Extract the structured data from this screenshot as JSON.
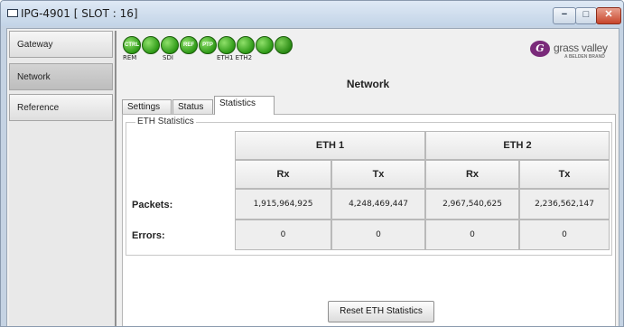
{
  "window": {
    "title": "IPG-4901 [ SLOT : 16]",
    "controls": {
      "minimize": "−",
      "maximize": "□",
      "close": "✕"
    }
  },
  "sidebar": {
    "items": [
      {
        "label": "Gateway",
        "active": false
      },
      {
        "label": "Network",
        "active": true
      },
      {
        "label": "Reference",
        "active": false
      }
    ]
  },
  "status_icons": {
    "icons": [
      {
        "name": "ctrl",
        "glyph": "CTRL"
      },
      {
        "name": "link",
        "glyph": ""
      },
      {
        "name": "sdi",
        "glyph": ""
      },
      {
        "name": "ref",
        "glyph": "REF"
      },
      {
        "name": "ptp",
        "glyph": "PTP"
      },
      {
        "name": "eth1",
        "glyph": ""
      },
      {
        "name": "eth2",
        "glyph": ""
      },
      {
        "name": "extra",
        "glyph": ""
      },
      {
        "name": "refresh",
        "glyph": ""
      }
    ],
    "labels": {
      "rem": "REM",
      "sdi": "SDI",
      "eth": "ETH1 ETH2"
    },
    "status_color": "#2e9a17"
  },
  "brand": {
    "logo_text": "grass valley",
    "sub_text": "A BELDEN BRAND",
    "mark_color": "#7a2a7a"
  },
  "main": {
    "title": "Network",
    "tabs": [
      {
        "label": "Settings",
        "active": false
      },
      {
        "label": "Status",
        "active": false
      },
      {
        "label": "Statistics",
        "active": true
      }
    ],
    "group_label": "ETH Statistics",
    "table": {
      "ports": [
        "ETH 1",
        "ETH 2"
      ],
      "columns": [
        "Rx",
        "Tx",
        "Rx",
        "Tx"
      ],
      "rows": [
        {
          "label": "Packets:",
          "values": [
            "1,915,964,925",
            "4,248,469,447",
            "2,967,540,625",
            "2,236,562,147"
          ]
        },
        {
          "label": "Errors:",
          "values": [
            "0",
            "0",
            "0",
            "0"
          ]
        }
      ]
    },
    "reset_button": "Reset ETH Statistics"
  }
}
